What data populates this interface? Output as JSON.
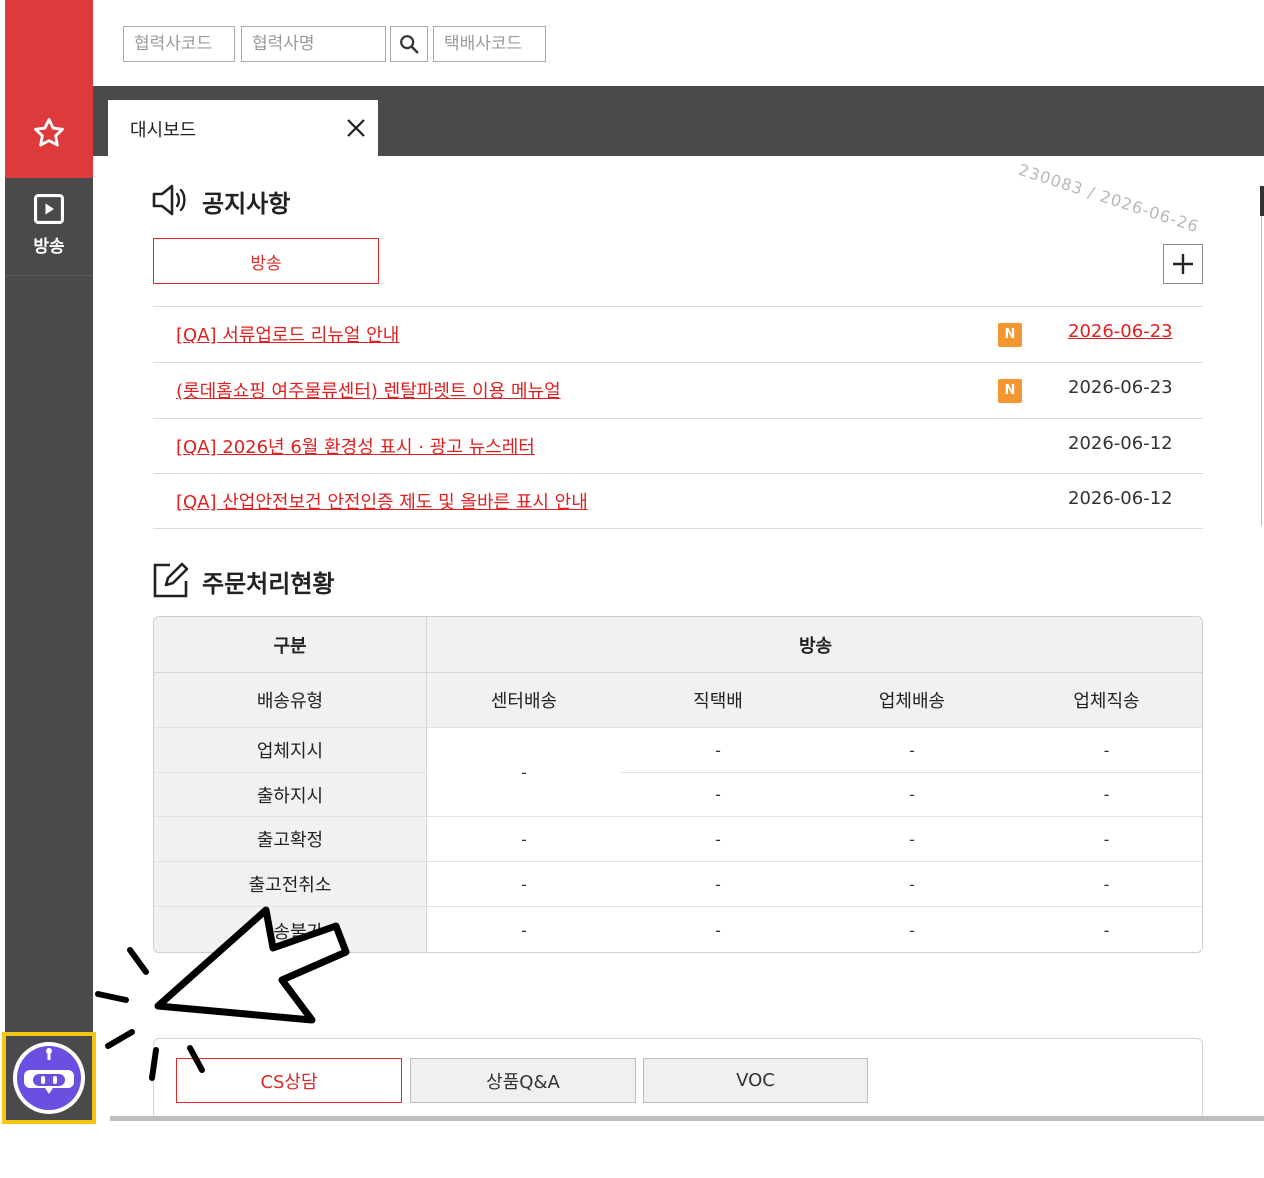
{
  "search": {
    "partner_code_placeholder": "협력사코드",
    "partner_name_placeholder": "협력사명",
    "courier_code_placeholder": "택배사코드"
  },
  "sidebar": {
    "favorites_icon": "star-icon",
    "broadcast_label": "방송",
    "broadcast_icon": "play-icon"
  },
  "tabs": {
    "dashboard_label": "대시보드"
  },
  "notice": {
    "title": "공지사항",
    "filter_button": "방송",
    "items": [
      {
        "title": "[QA] 서류업로드 리뉴얼 안내",
        "badge": "N",
        "date": "2026-06-23"
      },
      {
        "title": "(롯데홈쇼핑 여주물류센터) 렌탈파렛트 이용 메뉴얼",
        "badge": "N",
        "date": "2026-06-23"
      },
      {
        "title": "[QA] 2026년 6월 환경성 표시 · 광고 뉴스레터",
        "badge": "",
        "date": "2026-06-12"
      },
      {
        "title": "[QA] 산업안전보건 안전인증 제도 및 올바른 표시 안내",
        "badge": "",
        "date": "2026-06-12"
      }
    ]
  },
  "orders": {
    "title": "주문처리현황",
    "header_category": "구분",
    "header_channel": "방송",
    "delivery_type_label": "배송유형",
    "columns": [
      "센터배송",
      "직택배",
      "업체배송",
      "업체직송"
    ],
    "rows": [
      {
        "label": "업체지시",
        "values": [
          "-",
          "-",
          "-"
        ]
      },
      {
        "label": "출하지시",
        "values": [
          "-",
          "-",
          "-"
        ]
      },
      {
        "label": "출고확정",
        "values": [
          "-",
          "-",
          "-",
          "-"
        ]
      },
      {
        "label": "출고전취소",
        "values": [
          "-",
          "-",
          "-",
          "-"
        ]
      },
      {
        "label": "배송불가",
        "values": [
          "-",
          "-",
          "-",
          "-"
        ]
      }
    ],
    "merged_center_value": "-"
  },
  "watermark": "230083 / 2026-06-26",
  "cs_tabs": [
    "CS상담",
    "상품Q&A",
    "VOC"
  ],
  "colors": {
    "brand_red": "#dd3b3b",
    "sidebar_gray": "#4a4a4a",
    "highlight_yellow": "#f3c614",
    "badge_orange": "#f39530",
    "bot_purple": "#6b4fe0"
  }
}
